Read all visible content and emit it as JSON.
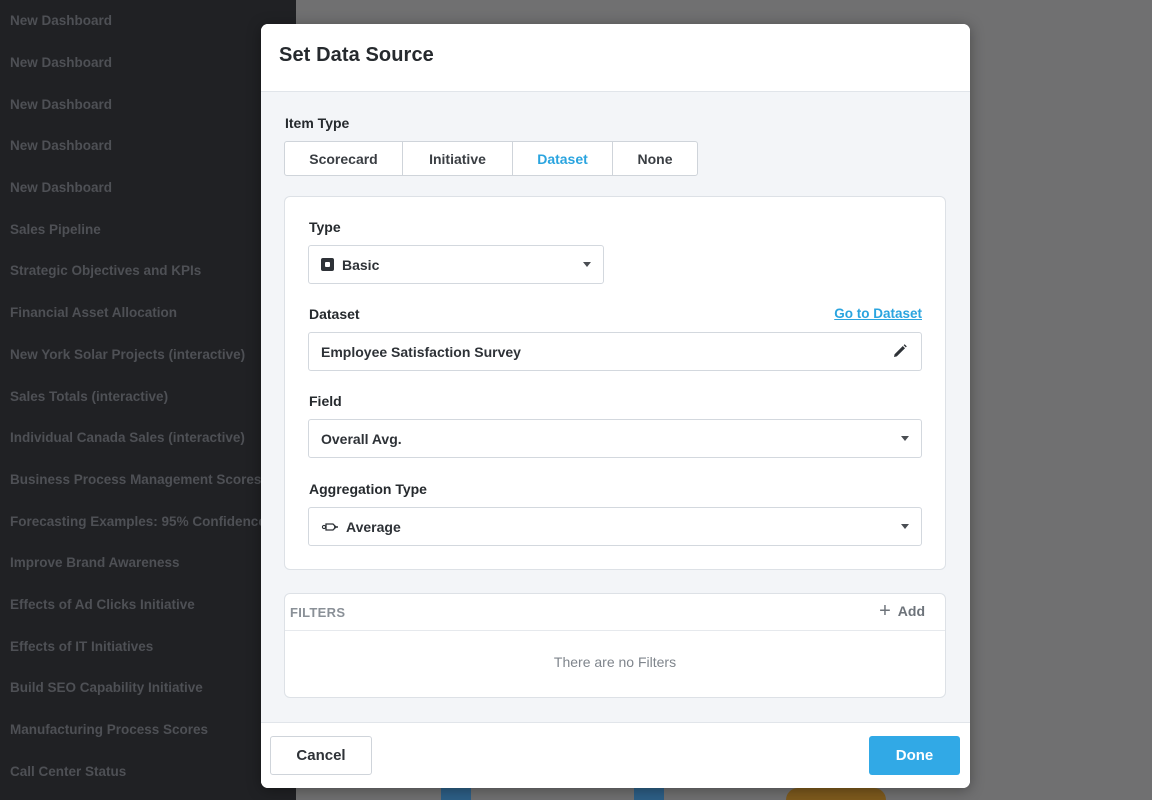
{
  "sidebar": {
    "items": [
      {
        "label": "New Dashboard"
      },
      {
        "label": "New Dashboard"
      },
      {
        "label": "New Dashboard"
      },
      {
        "label": "New Dashboard"
      },
      {
        "label": "New Dashboard"
      },
      {
        "label": "Sales Pipeline"
      },
      {
        "label": "Strategic Objectives and KPIs"
      },
      {
        "label": "Financial Asset Allocation"
      },
      {
        "label": "New York Solar Projects (interactive)"
      },
      {
        "label": "Sales Totals (interactive)"
      },
      {
        "label": "Individual Canada Sales (interactive)"
      },
      {
        "label": "Business Process Management Scores"
      },
      {
        "label": "Forecasting Examples: 95% Confidence"
      },
      {
        "label": "Improve Brand Awareness"
      },
      {
        "label": "Effects of Ad Clicks Initiative"
      },
      {
        "label": "Effects of IT Initiatives"
      },
      {
        "label": "Build SEO Capability Initiative"
      },
      {
        "label": "Manufacturing Process Scores"
      },
      {
        "label": "Call Center Status"
      }
    ]
  },
  "modal": {
    "title": "Set Data Source",
    "item_type": {
      "label": "Item Type",
      "options": [
        "Scorecard",
        "Initiative",
        "Dataset",
        "None"
      ],
      "selected": "Dataset"
    },
    "type": {
      "label": "Type",
      "value": "Basic",
      "icon": "basic-square-icon"
    },
    "dataset": {
      "label": "Dataset",
      "link": "Go to Dataset",
      "value": "Employee Satisfaction Survey"
    },
    "field": {
      "label": "Field",
      "value": "Overall Avg."
    },
    "aggregation": {
      "label": "Aggregation Type",
      "value": "Average",
      "icon": "average-icon"
    },
    "filters": {
      "title": "FILTERS",
      "add_label": "Add",
      "empty_message": "There are no Filters"
    },
    "footer": {
      "cancel_label": "Cancel",
      "done_label": "Done"
    }
  },
  "colors": {
    "accent": "#2aa4df",
    "done_button": "#31a9e6",
    "sidebar_bg": "#202124",
    "overlay": "#6f6f70"
  }
}
